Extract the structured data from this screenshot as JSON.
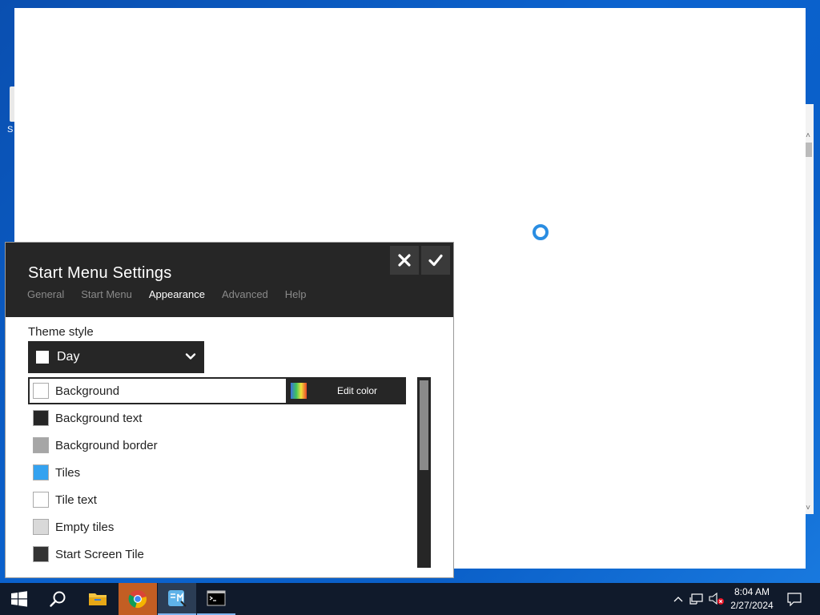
{
  "desktop": {
    "left_icon_label": "S"
  },
  "settings": {
    "title": "Start Menu Settings",
    "tabs": [
      {
        "label": "General",
        "active": false
      },
      {
        "label": "Start Menu",
        "active": false
      },
      {
        "label": "Appearance",
        "active": true
      },
      {
        "label": "Advanced",
        "active": false
      },
      {
        "label": "Help",
        "active": false
      }
    ],
    "theme_label": "Theme style",
    "theme_value": "Day",
    "colors": [
      {
        "label": "Background",
        "color": "#ffffff",
        "selected": true
      },
      {
        "label": "Background text",
        "color": "#262626",
        "selected": false
      },
      {
        "label": "Background border",
        "color": "#a6a6a6",
        "selected": false
      },
      {
        "label": "Tiles",
        "color": "#34a2f0",
        "selected": false
      },
      {
        "label": "Tile text",
        "color": "#ffffff",
        "selected": false
      },
      {
        "label": "Empty tiles",
        "color": "#d9d9d9",
        "selected": false
      },
      {
        "label": "Start Screen Tile",
        "color": "#333333",
        "selected": false
      }
    ],
    "edit_color_label": "Edit color",
    "icons": {
      "close": "close-icon",
      "ok": "checkmark-icon",
      "dropdown": "chevron-down-icon",
      "palette": "color-gradient-icon"
    }
  },
  "taskbar": {
    "time": "8:04 AM",
    "date": "2/27/2024",
    "apps": [
      "windows-start",
      "search",
      "file-explorer",
      "chrome",
      "start-menu-app",
      "command-prompt"
    ]
  },
  "colors": {
    "header_bg": "#262626",
    "accent": "#2a8de2",
    "taskbar_bg": "#101a2b"
  }
}
